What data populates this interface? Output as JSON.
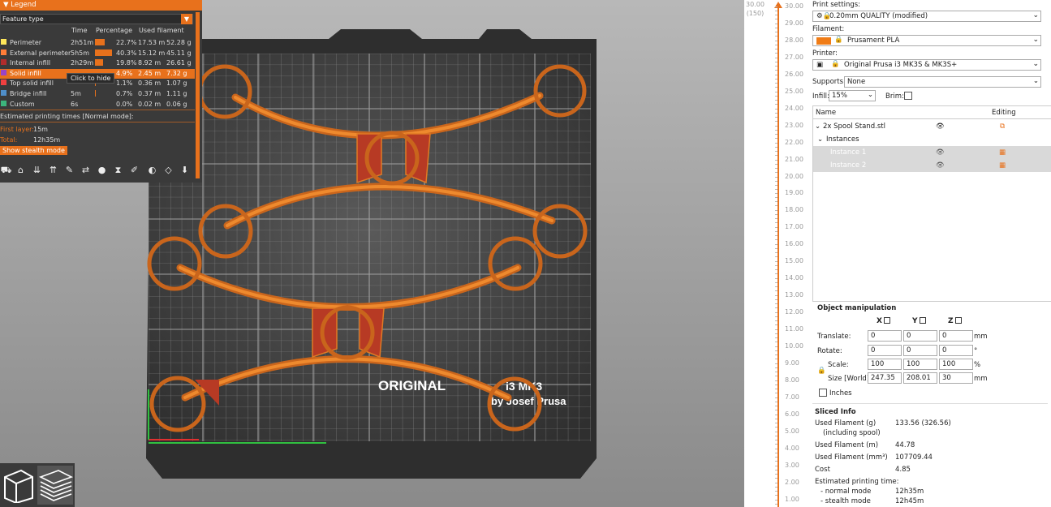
{
  "legend": {
    "title": "Legend",
    "feature_type": "Feature type",
    "col_time": "Time",
    "col_percentage": "Percentage",
    "col_used": "Used filament",
    "rows": [
      {
        "name": "Perimeter",
        "time": "2h51m",
        "pct": "22.7%",
        "len": "17.53 m",
        "g": "52.28 g",
        "color": "#ffe65a",
        "fill": 0.227
      },
      {
        "name": "External perimeter",
        "time": "5h5m",
        "pct": "40.3%",
        "len": "15.12 m",
        "g": "45.11 g",
        "color": "#ff7d38",
        "fill": 0.403
      },
      {
        "name": "Internal infill",
        "time": "2h29m",
        "pct": "19.8%",
        "len": "8.92 m",
        "g": "26.61 g",
        "color": "#b02c2c",
        "fill": 0.198
      },
      {
        "name": "Solid infill",
        "time": "",
        "pct": "4.9%",
        "len": "2.45 m",
        "g": "7.32 g",
        "color": "#9a44c8",
        "fill": 0.049
      },
      {
        "name": "Top solid infill",
        "time": "",
        "pct": "1.1%",
        "len": "0.36 m",
        "g": "1.07 g",
        "color": "#f04040",
        "fill": 0.011
      },
      {
        "name": "Bridge infill",
        "time": "5m",
        "pct": "0.7%",
        "len": "0.37 m",
        "g": "1.11 g",
        "color": "#4f8ec9",
        "fill": 0.007
      },
      {
        "name": "Custom",
        "time": "6s",
        "pct": "0.0%",
        "len": "0.02 m",
        "g": "0.06 g",
        "color": "#3cb47c",
        "fill": 0.0
      }
    ],
    "tooltip": "Click to hide",
    "est_title": "Estimated printing times [Normal mode]:",
    "first_layer_label": "First layer:",
    "first_layer_value": "15m",
    "total_label": "Total:",
    "total_value": "12h35m",
    "stealth_button": "Show stealth mode"
  },
  "bed_text": {
    "line1": "ORIGINAL",
    "line1b": "i3 MK3",
    "line2": "by Josef Prusa"
  },
  "slider": {
    "top_value": "30.00",
    "top_sub": "(150)",
    "ticks": [
      "30.00",
      "29.00",
      "28.00",
      "27.00",
      "26.00",
      "25.00",
      "24.00",
      "23.00",
      "22.00",
      "21.00",
      "20.00",
      "19.00",
      "18.00",
      "17.00",
      "16.00",
      "15.00",
      "14.00",
      "13.00",
      "12.00",
      "11.00",
      "10.00",
      "9.00",
      "8.00",
      "7.00",
      "6.00",
      "5.00",
      "4.00",
      "3.00",
      "2.00",
      "1.00"
    ]
  },
  "panel": {
    "print_settings_label": "Print settings:",
    "print_settings_value": "0.20mm QUALITY (modified)",
    "filament_label": "Filament:",
    "filament_value": "Prusament PLA",
    "filament_color": "#f07c16",
    "printer_label": "Printer:",
    "printer_value": "Original Prusa i3 MK3S & MK3S+",
    "supports_label": "Supports:",
    "supports_value": "None",
    "infill_label": "Infill:",
    "infill_value": "15%",
    "brim_label": "Brim:",
    "list_col_name": "Name",
    "list_col_editing": "Editing",
    "object_name": "2x Spool Stand.stl",
    "instances_label": "Instances",
    "instance1": "Instance 1",
    "instance2": "Instance 2"
  },
  "object_manipulation": {
    "title": "Object manipulation",
    "x": "X",
    "y": "Y",
    "z": "Z",
    "translate_label": "Translate:",
    "translate": [
      "0",
      "0",
      "0"
    ],
    "translate_unit": "mm",
    "rotate_label": "Rotate:",
    "rotate": [
      "0",
      "0",
      "0"
    ],
    "rotate_unit": "°",
    "scale_label": "Scale:",
    "scale": [
      "100",
      "100",
      "100"
    ],
    "scale_unit": "%",
    "size_label": "Size [World]:",
    "size": [
      "247.35",
      "208.01",
      "30"
    ],
    "size_unit": "mm",
    "inches_label": "Inches"
  },
  "sliced_info": {
    "title": "Sliced Info",
    "used_g_label": "Used Filament (g)",
    "used_g_sub": "(including spool)",
    "used_g_value": "133.56 (326.56)",
    "used_m_label": "Used Filament (m)",
    "used_m_value": "44.78",
    "used_mm3_label": "Used Filament (mm³)",
    "used_mm3_value": "107709.44",
    "cost_label": "Cost",
    "cost_value": "4.85",
    "est_label": "Estimated printing time:",
    "normal_label": "- normal mode",
    "normal_value": "12h35m",
    "stealth_label": "- stealth mode",
    "stealth_value": "12h45m"
  }
}
